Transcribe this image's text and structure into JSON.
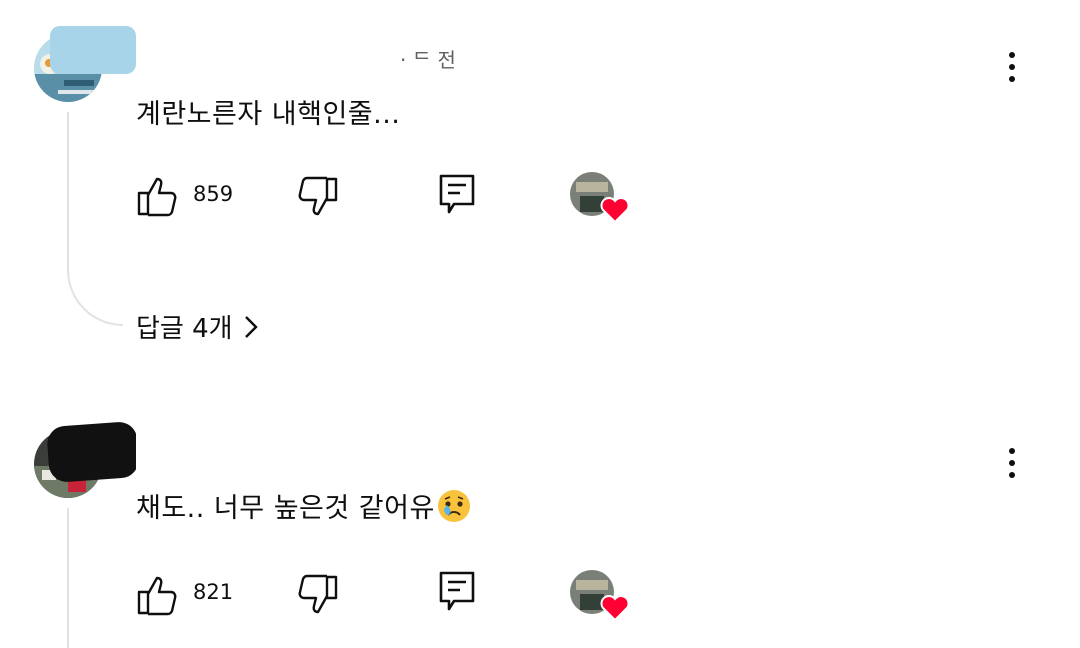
{
  "comments": [
    {
      "meta_visible": "· ᄃ 전",
      "text": "계란노른자 내핵인줄...",
      "likes": "859",
      "replies_label": "답글 4개"
    },
    {
      "text": "채도.. 너무 높은것 같어유",
      "emoji": "crying-face",
      "likes": "821"
    }
  ],
  "icons": {
    "like": "thumbs-up-icon",
    "dislike": "thumbs-down-icon",
    "reply": "comment-icon",
    "more": "more-vertical-icon",
    "creator_heart": "heart-icon"
  },
  "colors": {
    "heart": "#ff0033",
    "text": "#0f0f0f",
    "secondary": "#606060",
    "thread_line": "#e2e2e2"
  }
}
